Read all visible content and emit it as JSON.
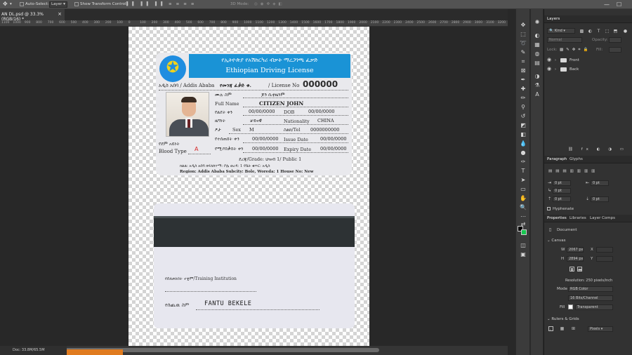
{
  "optbar": {
    "auto_select_label": "Auto-Select:",
    "auto_select_value": "Layer",
    "show_transform_label": "Show Transform Controls",
    "mode_label": "3D Mode:"
  },
  "document_tab": {
    "title": "AN DL.psd @ 33.3% (RGB/16) *"
  },
  "ruler": {
    "ticks": [
      "1100",
      "1000",
      "900",
      "800",
      "700",
      "600",
      "500",
      "400",
      "300",
      "200",
      "100",
      "0",
      "100",
      "200",
      "300",
      "400",
      "500",
      "600",
      "700",
      "800",
      "900",
      "1000",
      "1100",
      "1200",
      "1300",
      "1400",
      "1500",
      "1600",
      "1700",
      "1800",
      "1900",
      "2000",
      "2100",
      "2200",
      "2300",
      "2400",
      "2500",
      "2600",
      "2700",
      "2800",
      "2900",
      "3000",
      "3100",
      "3200"
    ]
  },
  "front_card": {
    "amharic_title": "የኢትዮጵያ የአሽከርካሪ ብቃት ማረጋገጫ ፈቃድ",
    "english_title": "Ethiopian Driving License",
    "address_label": "አዲስ አበባ / Addis Ababa",
    "license_label_am": "የመንጃ ፈቃድ ቁ.",
    "license_label_en": "/ License No",
    "license_no": "000000",
    "name_am_label": "ሙሉ ስም",
    "name_am_value": "ጆን ሲቲዜንም",
    "full_name_label": "Full Name",
    "full_name_value": "CITIZEN JOHN",
    "dob_am_label": "የልደት ቀን",
    "dob_am_value": "00/00/0000",
    "dob_label": "DOB",
    "dob_value": "00/00/0000",
    "nationality_am_label": "ዜግነት",
    "nationality_am_value": "ቻይናዊ",
    "nationality_label": "Nationality",
    "nationality_value": "CHINA",
    "sex_am_label": "ፆታ",
    "sex_label": "Sex",
    "sex_value": "M",
    "tel_label": "ስልክ/Tel",
    "tel_value": "0000000000",
    "issue_am_label": "የተሰጠበት ቀን",
    "issue_am_value": "00/00/0000",
    "issue_label": "Issue Date",
    "issue_value": "00/00/0000",
    "blood_am_label": "የደም አይነት",
    "blood_label": "Blood Type",
    "blood_value": "A",
    "expiry_am_label": "የሚያበቃበት ቀን",
    "expiry_am_value": "00/00/0000",
    "expiry_label": "Expiry Date",
    "expiry_value": "00/00/0000",
    "grade_line": "ደረጃ/Grade:  ህዝብ 1/ Public 1",
    "region_am_line": "ክልል: አዲስ አበባ ክፍለከተማ: ቦሌ ወረዳ: 1 የቤት ቁጥር: አዲስ",
    "region_line": "Region: Addis Ababa  Subcity: Bole, Woreda: 1 House No: New"
  },
  "back_card": {
    "institution_label": "የሰለጠነበት ተቋም/Training Institution",
    "signature_label": "የሰጪዉ ስም",
    "signature_value": "FANTU  BEKELE"
  },
  "status": {
    "doc_size": "Doc: 33.8M/65.5M"
  },
  "layers_panel": {
    "tab": "Layers",
    "kind": "Kind",
    "blend": "Normal",
    "opacity_label": "Opacity:",
    "lock_label": "Lock:",
    "fill_label": "Fill:",
    "layers": [
      {
        "name": "Front"
      },
      {
        "name": "Back"
      }
    ]
  },
  "paragraph_panel": {
    "tabs": [
      "Paragraph",
      "Glyphs"
    ],
    "indent_left": "0 pt",
    "indent_right": "0 pt",
    "indent_first": "0 pt",
    "space_before": "0 pt",
    "space_after": "0 pt",
    "hyphenate": "Hyphenate"
  },
  "properties_panel": {
    "tabs": [
      "Properties",
      "Libraries",
      "Layer Comps"
    ],
    "document_label": "Document",
    "canvas_section": "Canvas",
    "width_label": "W",
    "width_value": "2067 px",
    "height_label": "H",
    "height_value": "2894 px",
    "x_label": "X",
    "y_label": "Y",
    "resolution": "Resolution: 250 pixels/inch",
    "mode_label": "Mode",
    "mode_value": "RGB Color",
    "depth_value": "16 Bits/Channel",
    "fill_label": "Fill",
    "fill_value": "Transparent",
    "rulers_section": "Rulers & Grids",
    "units_value": "Pixels"
  },
  "colors": {
    "banner": "#1a93d6",
    "foreground": "#000000",
    "background": "#17c64f",
    "orange_tab": "#e07b1f"
  }
}
